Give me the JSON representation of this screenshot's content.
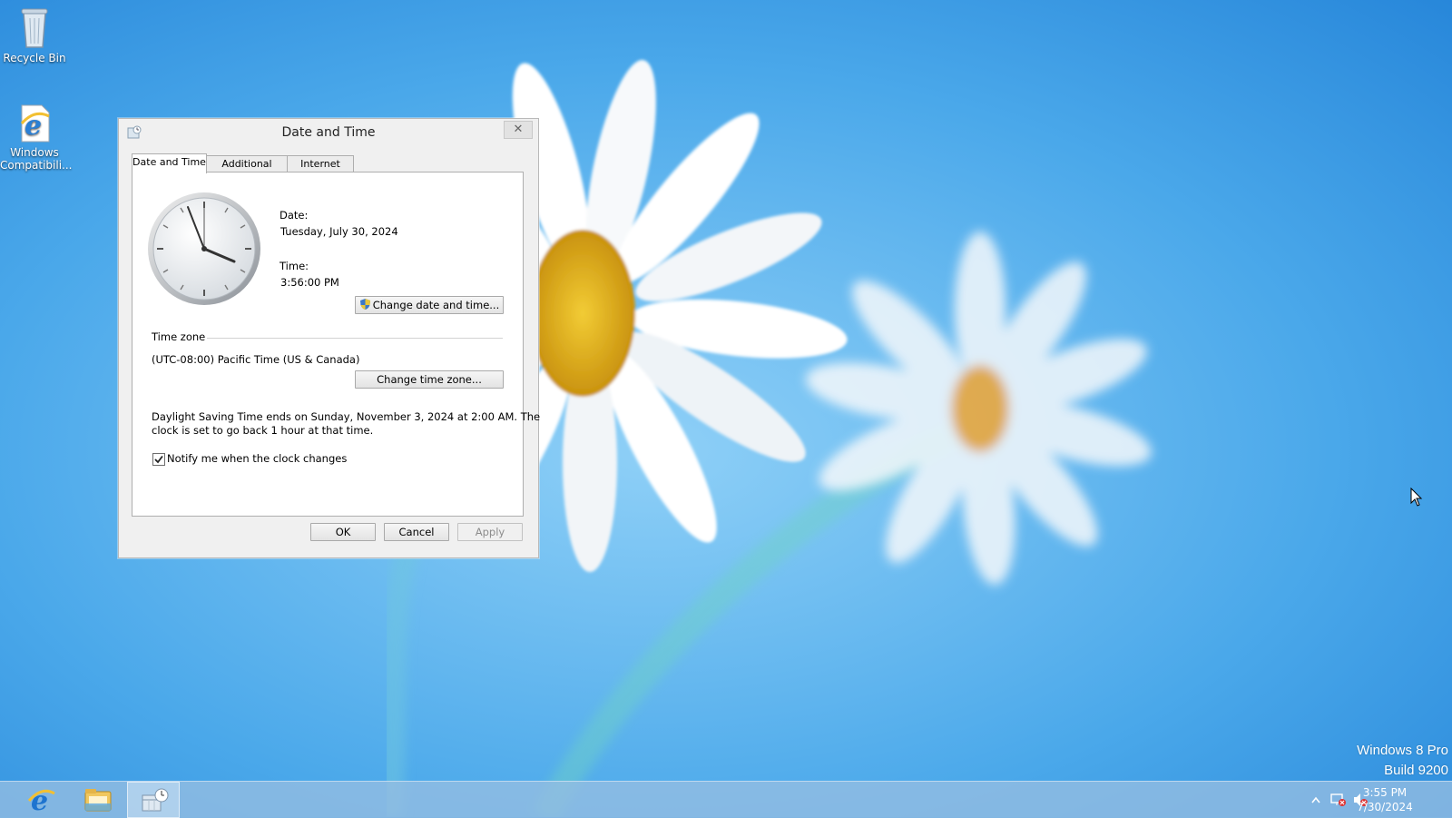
{
  "desktop": {
    "icons": [
      {
        "label": "Recycle Bin",
        "icon": "recycle-bin-icon"
      },
      {
        "label": "Windows Compatibili...",
        "icon": "internet-explorer-document-icon"
      }
    ],
    "watermark": {
      "line1": "Windows 8 Pro",
      "line2": "Build 9200"
    }
  },
  "dialog": {
    "title": "Date and Time",
    "icon": "date-time-app-icon",
    "close_symbol": "✕",
    "tabs": [
      {
        "label": "Date and Time",
        "active": true
      },
      {
        "label": "Additional Clocks",
        "active": false
      },
      {
        "label": "Internet Time",
        "active": false
      }
    ],
    "date_label": "Date:",
    "date_value": "Tuesday, July 30, 2024",
    "time_label": "Time:",
    "time_value": "3:56:00 PM",
    "change_datetime_label": "Change date and time...",
    "timezone_heading": "Time zone",
    "timezone_value": "(UTC-08:00) Pacific Time (US & Canada)",
    "change_timezone_label": "Change time zone...",
    "dst_line1": "Daylight Saving Time ends on Sunday, November 3, 2024 at 2:00 AM. The",
    "dst_line2": "clock is set to go back 1 hour at that time.",
    "notify_label": "Notify me when the clock changes",
    "notify_checked": true,
    "ok_label": "OK",
    "cancel_label": "Cancel",
    "apply_label": "Apply"
  },
  "taskbar": {
    "pinned": [
      {
        "icon": "internet-explorer-icon"
      },
      {
        "icon": "file-explorer-icon"
      },
      {
        "icon": "control-panel-icon",
        "active": true
      }
    ],
    "tray_icons": [
      "show-hidden-icons-icon",
      "network-error-icon",
      "volume-muted-icon"
    ],
    "clock_time": "3:55 PM",
    "clock_date": "7/30/2024"
  },
  "colors": {
    "accent": "#3a9be4",
    "flower_center": "#e0b020"
  }
}
